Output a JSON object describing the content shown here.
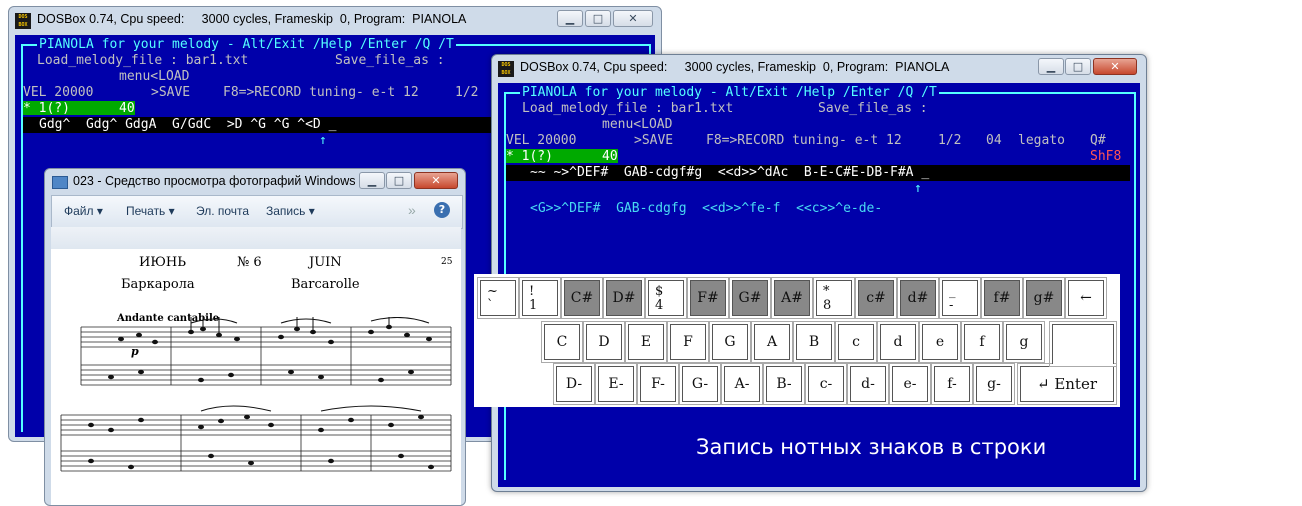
{
  "colors": {
    "dos_bg": "#0000aa",
    "cyan": "#55ffff",
    "green": "#00aa00",
    "red": "#ff5555"
  },
  "back_window": {
    "title": "DOSBox 0.74, Cpu speed:     3000 cycles, Frameskip  0, Program:  PIANOLA",
    "header": "PIANOLA for your melody - Alt/Exit /Help /Enter /Q /T",
    "load_file": "Load_melody_file : bar1.txt",
    "save_file": "Save_file_as :",
    "menu": "menu<LOAD",
    "vel": "VEL 20000",
    "save": ">SAVE",
    "record": "F8=>RECORD tuning- e-t 12",
    "ratio": "1/2",
    "track": "* 1(?)",
    "track_num": "40",
    "notes": "Gdg^  Gdg^ GdgA  G/GdC  >D ^G ^G ^<D _",
    "arrow": "↑"
  },
  "photo_viewer": {
    "title": "023 - Средство просмотра фотографий Windows",
    "menu": [
      "Файл",
      "Печать",
      "Эл. почта",
      "Запись"
    ],
    "more": "»",
    "help": "?",
    "sheet": {
      "month_ru": "ИЮНЬ",
      "number": "№ 6",
      "month_fr": "JUIN",
      "page": "25",
      "title_ru": "Баркарола",
      "title_fr": "Barcarolle",
      "tempo": "Andante cantabile",
      "dynamic": "p"
    }
  },
  "front_window": {
    "title": "DOSBox 0.74, Cpu speed:     3000 cycles, Frameskip  0, Program:  PIANOLA",
    "header": "PIANOLA for your melody - Alt/Exit /Help /Enter /Q /T",
    "load_file": "Load_melody_file : bar1.txt",
    "save_file": "Save_file_as :",
    "menu": "menu<LOAD",
    "vel": "VEL 20000",
    "save": ">SAVE",
    "record": "F8=>RECORD tuning- e-t 12",
    "ratio": "1/2",
    "octave": "04",
    "mode": "legato",
    "q": "Q#",
    "shf": "ShF8",
    "track": "* 1(?)",
    "track_num": "40",
    "notes": "~~ ~>^DEF#  GAB-cdgf#g  <<d>>^dAc  B-E-C#E-DB-F#A _",
    "arrow": "↑",
    "line2": "<G>>^DEF#  GAB-cdgfg  <<d>>^fe-f  <<c>>^e-de-",
    "caption": "Запись нотных знаков в строки"
  },
  "keyboard": {
    "row1": [
      {
        "top": "~",
        "bot": "`",
        "dark": false
      },
      {
        "top": "!",
        "bot": "1",
        "dark": false
      },
      {
        "label": "C#",
        "dark": true
      },
      {
        "label": "D#",
        "dark": true
      },
      {
        "top": "$",
        "bot": "4",
        "dark": false
      },
      {
        "label": "F#",
        "dark": true
      },
      {
        "label": "G#",
        "dark": true
      },
      {
        "label": "A#",
        "dark": true
      },
      {
        "top": "*",
        "bot": "8",
        "dark": false
      },
      {
        "label": "c#",
        "dark": true
      },
      {
        "label": "d#",
        "dark": true
      },
      {
        "top": "_",
        "bot": "-",
        "dark": false
      },
      {
        "label": "f#",
        "dark": true
      },
      {
        "label": "g#",
        "dark": true
      },
      {
        "label": "←",
        "dark": false
      }
    ],
    "row2": [
      "C",
      "D",
      "E",
      "F",
      "G",
      "A",
      "B",
      "c",
      "d",
      "e",
      "f",
      "g"
    ],
    "row3": [
      "D-",
      "E-",
      "F-",
      "G-",
      "A-",
      "B-",
      "c-",
      "d-",
      "e-",
      "f-",
      "g-"
    ],
    "enter": "↵ Enter"
  }
}
